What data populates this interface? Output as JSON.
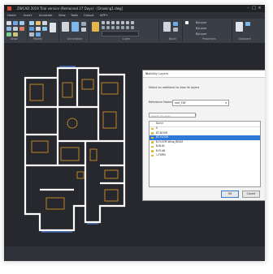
{
  "colors": {
    "titlebar_bg": "#1e2024",
    "ribbon_bg": "#3a3e46",
    "canvas_bg": "#26282d",
    "wall": "#ffffff",
    "furniture": "#e39a2a",
    "window_line": "#4a7fe0",
    "selection": "#2f78d7"
  },
  "window": {
    "title": "ZWCAD 2019 Trial version (Remained 27 Days) - [Drawing1.dwg]"
  },
  "menu": {
    "items": [
      "Home",
      "Insert",
      "Annotate",
      "View",
      "Tools",
      "Output",
      "APP+"
    ]
  },
  "ribbon": {
    "groups": [
      "Draw",
      "Modify",
      "Annotation",
      "Layer",
      "Block",
      "Properties",
      "Clipboard"
    ],
    "properties_values": [
      "ByLayer",
      "ByLayer",
      "ByLayer"
    ]
  },
  "dialog": {
    "title": "Visibility Layers",
    "instruction": "Select an xrefblock to view its layers",
    "reference_label": "Reference Name:",
    "reference_value": "xref_FDF",
    "search_placeholder": "Search for layer",
    "list_header": "Name",
    "layers": [
      {
        "name": "0",
        "selected": false
      },
      {
        "name": "BT-DOOR",
        "selected": false
      },
      {
        "name": "BT-FLOOR",
        "selected": true
      },
      {
        "name": "B-FLOOR Wrap_BEAM",
        "selected": false
      },
      {
        "name": "B-W-IN",
        "selected": false
      },
      {
        "name": "B-PLAN",
        "selected": false
      },
      {
        "name": "1-FURN",
        "selected": false
      }
    ],
    "ok_label": "OK",
    "cancel_label": "Cancel"
  }
}
